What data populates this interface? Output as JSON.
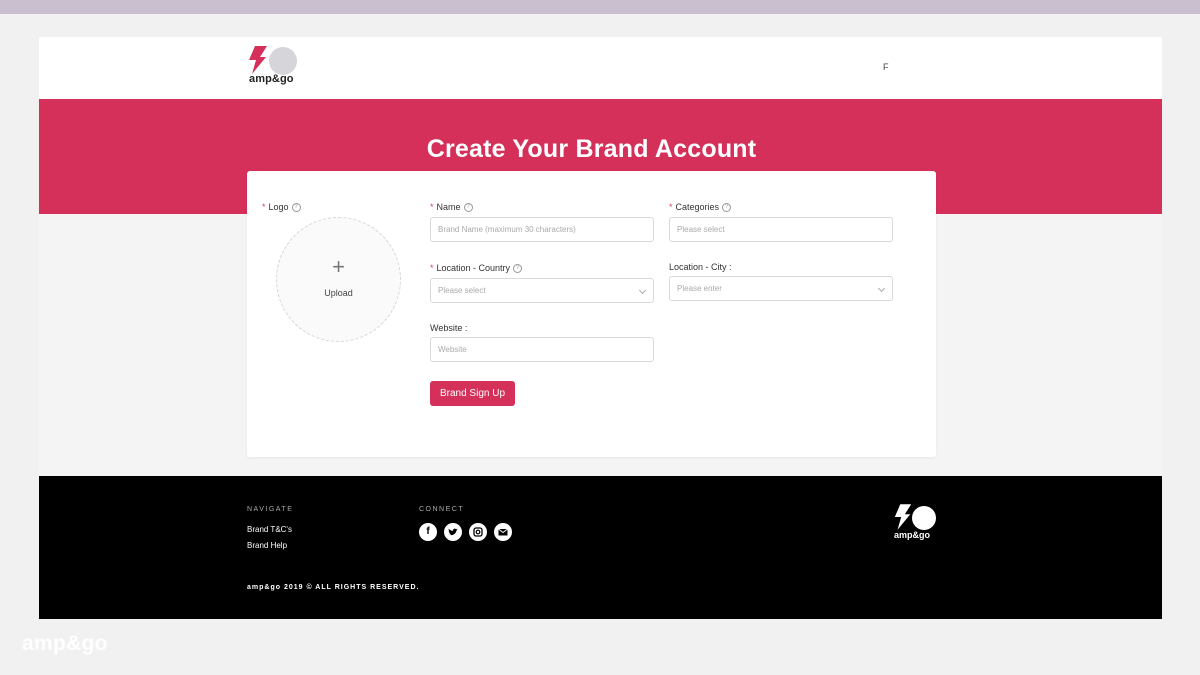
{
  "brand": {
    "wordmark": "amp&go",
    "accent": "#d4305a"
  },
  "header": {
    "menu_letter": "F"
  },
  "hero": {
    "title": "Create Your Brand Account"
  },
  "form": {
    "logo": {
      "label": "Logo",
      "upload_text": "Upload"
    },
    "name": {
      "label": "Name",
      "placeholder": "Brand Name (maximum 30 characters)"
    },
    "categories": {
      "label": "Categories",
      "placeholder": "Please select"
    },
    "country": {
      "label": "Location - Country",
      "placeholder": "Please select"
    },
    "city": {
      "label": "Location - City :",
      "placeholder": "Please enter"
    },
    "website": {
      "label": "Website :",
      "placeholder": "Website"
    },
    "submit_label": "Brand Sign Up"
  },
  "footer": {
    "navigate_heading": "NAVIGATE",
    "links": [
      "Brand T&C's",
      "Brand Help"
    ],
    "connect_heading": "CONNECT",
    "social_icons": [
      "facebook-icon",
      "twitter-icon",
      "instagram-icon",
      "email-icon"
    ],
    "copyright": "amp&go 2019 © ALL RIGHTS RESERVED."
  },
  "watermark": "amp&go"
}
